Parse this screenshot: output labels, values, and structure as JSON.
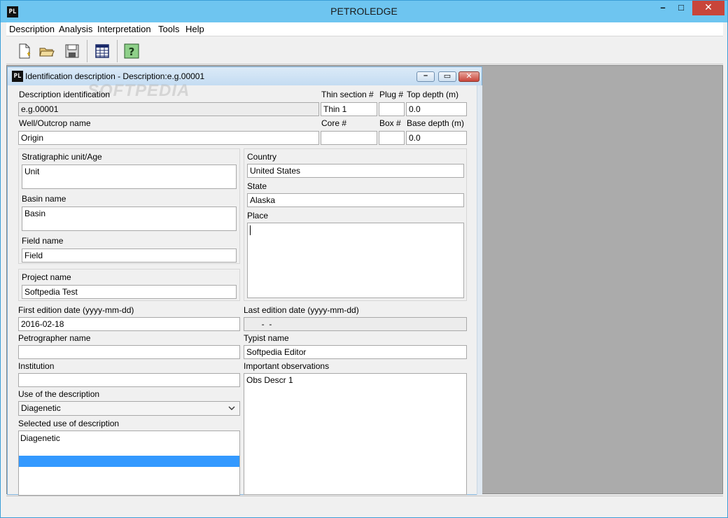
{
  "app": {
    "title": "PETROLEDGE",
    "logo": "PL",
    "window_controls": {
      "minimize": "minimize-icon",
      "maximize": "maximize-icon",
      "close": "close-icon"
    }
  },
  "menu": {
    "items": [
      "Description",
      "Analysis",
      "Interpretation",
      "Tools",
      "Help"
    ]
  },
  "toolbar": {
    "icons": [
      "new-document-icon",
      "open-folder-icon",
      "save-disk-icon",
      "table-grid-icon",
      "help-question-icon"
    ]
  },
  "child_window": {
    "logo": "PL",
    "title": "Identification description - Description:e.g.00001",
    "watermark": "SOFTPEDIA"
  },
  "form": {
    "description_identification": {
      "label": "Description identification",
      "value": "e.g.00001"
    },
    "thin_section": {
      "label": "Thin section #",
      "value": "Thin 1"
    },
    "plug": {
      "label": "Plug #",
      "value": ""
    },
    "top_depth": {
      "label": "Top depth (m)",
      "value": "0.0"
    },
    "well_outcrop": {
      "label": "Well/Outcrop name",
      "value": "Origin"
    },
    "core": {
      "label": "Core #",
      "value": ""
    },
    "box": {
      "label": "Box #",
      "value": ""
    },
    "base_depth": {
      "label": "Base depth (m)",
      "value": "0.0"
    },
    "stratigraphic_unit": {
      "label": "Stratigraphic unit/Age",
      "value": "Unit"
    },
    "basin_name": {
      "label": "Basin name",
      "value": "Basin"
    },
    "field_name": {
      "label": "Field name",
      "value": "Field"
    },
    "project_name": {
      "label": "Project name",
      "value": "Softpedia Test"
    },
    "country": {
      "label": "Country",
      "value": "United States"
    },
    "state": {
      "label": "State",
      "value": "Alaska"
    },
    "place": {
      "label": "Place",
      "value": ""
    },
    "first_edition_date": {
      "label": "First edition date (yyyy-mm-dd)",
      "value": "2016-02-18"
    },
    "last_edition_date": {
      "label": "Last edition date (yyyy-mm-dd)",
      "value": "  -  -"
    },
    "petrographer_name": {
      "label": "Petrographer name",
      "value": ""
    },
    "typist_name": {
      "label": "Typist name",
      "value": "Softpedia Editor"
    },
    "institution": {
      "label": "Institution",
      "value": ""
    },
    "important_observations": {
      "label": "Important observations",
      "value": "Obs Descr 1"
    },
    "use_of_description": {
      "label": "Use of the description",
      "value": "Diagenetic"
    },
    "selected_use": {
      "label": "Selected use of description",
      "items": [
        "Diagenetic"
      ]
    }
  }
}
